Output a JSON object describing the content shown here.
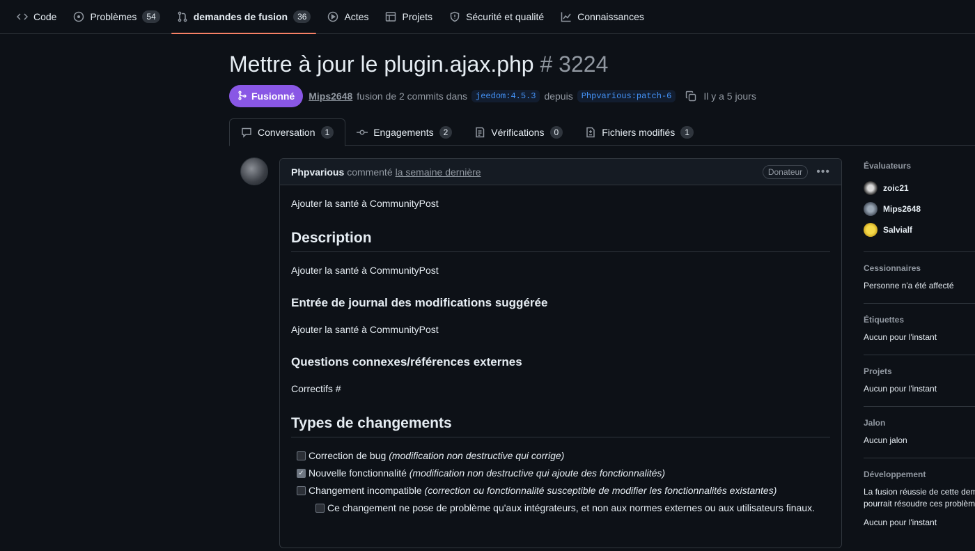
{
  "nav": [
    {
      "label": "Code",
      "icon": "code-icon"
    },
    {
      "label": "Problèmes",
      "count": "54",
      "icon": "issue-icon"
    },
    {
      "label": "demandes de fusion",
      "count": "36",
      "icon": "pull-request-icon",
      "active": true
    },
    {
      "label": "Actes",
      "icon": "play-icon"
    },
    {
      "label": "Projets",
      "icon": "table-icon"
    },
    {
      "label": "Sécurité et qualité",
      "icon": "shield-icon"
    },
    {
      "label": "Connaissances",
      "icon": "graph-icon"
    }
  ],
  "pr": {
    "title": "Mettre à jour le plugin.ajax.php",
    "number": "# 3224",
    "state": "Fusionné",
    "author": "Mips2648",
    "action": "fusion de 2 commits dans",
    "base_branch": "jeedom:4.5.3",
    "from": "depuis",
    "head_branch": "Phpvarious:patch-6",
    "time": "Il y a 5 jours"
  },
  "tabs": [
    {
      "label": "Conversation",
      "count": "1",
      "icon": "comment-icon"
    },
    {
      "label": "Engagements",
      "count": "2",
      "icon": "commit-icon"
    },
    {
      "label": "Vérifications",
      "count": "0",
      "icon": "checklist-icon"
    },
    {
      "label": "Fichiers modifiés",
      "count": "1",
      "icon": "file-diff-icon"
    }
  ],
  "comment": {
    "author": "Phpvarious",
    "verb": "commenté",
    "when": "la semaine dernière",
    "badge": "Donateur",
    "intro": "Ajouter la santé à CommunityPost",
    "h_description": "Description",
    "description": "Ajouter la santé à CommunityPost",
    "h_changelog": "Entrée de journal des modifications suggérée",
    "changelog": "Ajouter la santé à CommunityPost",
    "h_related": "Questions connexes/références externes",
    "related": "Correctifs #",
    "h_types": "Types de changements",
    "checks": [
      {
        "label": "Correction de bug",
        "note": "(modification non destructive qui corrige)",
        "checked": false
      },
      {
        "label": "Nouvelle fonctionnalité",
        "note": "(modification non destructive qui ajoute des fonctionnalités)",
        "checked": true
      },
      {
        "label": "Changement incompatible",
        "note": "(correction ou fonctionnalité susceptible de modifier les fonctionnalités existantes)",
        "checked": false
      }
    ],
    "subcheck": "Ce changement ne pose de problème qu'aux intégrateurs, et non aux normes externes ou aux utilisateurs finaux."
  },
  "sidebar": {
    "reviewers_title": "Évaluateurs",
    "reviewers": [
      "zoic21",
      "Mips2648",
      "Salvialf"
    ],
    "assignees_title": "Cessionnaires",
    "assignees": "Personne n'a été affecté",
    "labels_title": "Étiquettes",
    "labels": "Aucun pour l'instant",
    "projects_title": "Projets",
    "projects": "Aucun pour l'instant",
    "milestone_title": "Jalon",
    "milestone": "Aucun jalon",
    "development_title": "Développement",
    "development": "La fusion réussie de cette demande pourrait résoudre ces problèmes.",
    "development_none": "Aucun pour l'instant"
  },
  "colors": {
    "merged": "#8957e5",
    "accent": "#f78166",
    "link": "#4493f8"
  }
}
